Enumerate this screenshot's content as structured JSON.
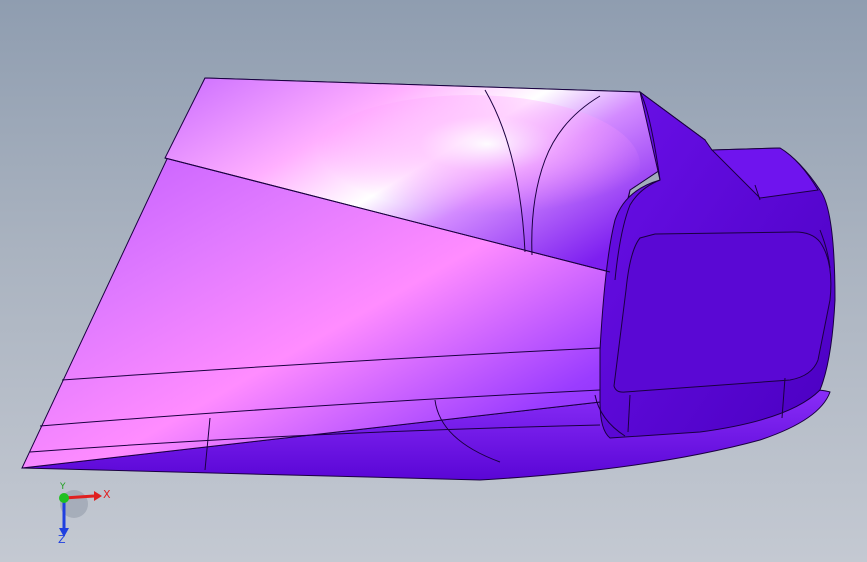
{
  "colors": {
    "background_top": "#8f9db0",
    "background_bottom": "#c4c9d2",
    "part_base": "#7a1ff2",
    "part_highlight": "#ff7cff",
    "part_shadow": "#4a00b8",
    "edge": "#1a0040",
    "axis_x": "#e02020",
    "axis_y": "#20b020",
    "axis_z": "#2040e0"
  },
  "view_triad": {
    "x_label": "X",
    "y_label": "Y",
    "z_label": "Z"
  }
}
